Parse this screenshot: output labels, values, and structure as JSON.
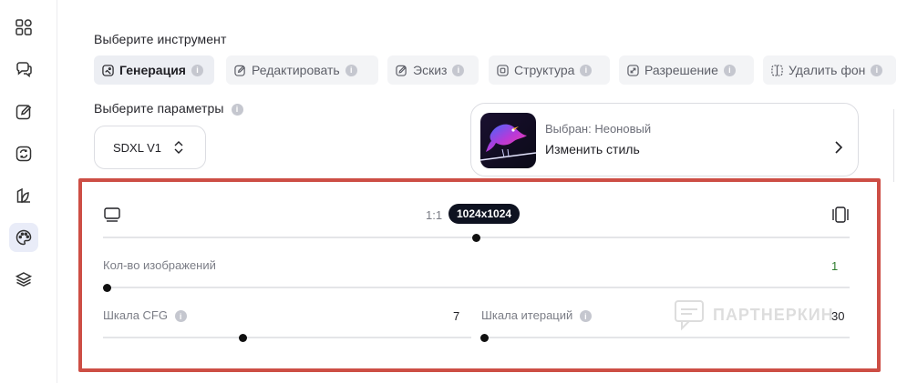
{
  "sidebar": {
    "items": [
      {
        "icon": "grid-icon"
      },
      {
        "icon": "chat-icon"
      },
      {
        "icon": "edit-icon"
      },
      {
        "icon": "refresh-icon"
      },
      {
        "icon": "brand-icon"
      },
      {
        "icon": "palette-icon",
        "active": true
      },
      {
        "icon": "layers-icon"
      }
    ]
  },
  "tools": {
    "title": "Выберите инструмент",
    "items": [
      {
        "label": "Генерация",
        "icon": "image-gen-icon",
        "active": true
      },
      {
        "label": "Редактировать",
        "icon": "edit-image-icon"
      },
      {
        "label": "Эскиз",
        "icon": "sketch-icon"
      },
      {
        "label": "Структура",
        "icon": "structure-icon"
      },
      {
        "label": "Разрешение",
        "icon": "resolution-icon"
      },
      {
        "label": "Удалить фон",
        "icon": "remove-bg-icon"
      }
    ]
  },
  "params": {
    "title": "Выберите параметры",
    "model": "SDXL V1"
  },
  "style": {
    "selected_label": "Выбран: Неоновый",
    "change_label": "Изменить стиль"
  },
  "aspect": {
    "ratio": "1:1",
    "size": "1024x1024",
    "position": 0.5
  },
  "count": {
    "label": "Кол-во изображений",
    "value": "1",
    "position": 0.0
  },
  "cfg": {
    "label": "Шкала CFG",
    "value": "7",
    "position": 0.38
  },
  "iterations": {
    "label": "Шкала итераций",
    "value": "30",
    "position": 0.0
  },
  "watermark": "ПАРТНЕРКИН",
  "colors": {
    "accent_frame": "#cd4e45",
    "active_sidebar": "#e9ecf8",
    "pill": "#0e1220"
  }
}
